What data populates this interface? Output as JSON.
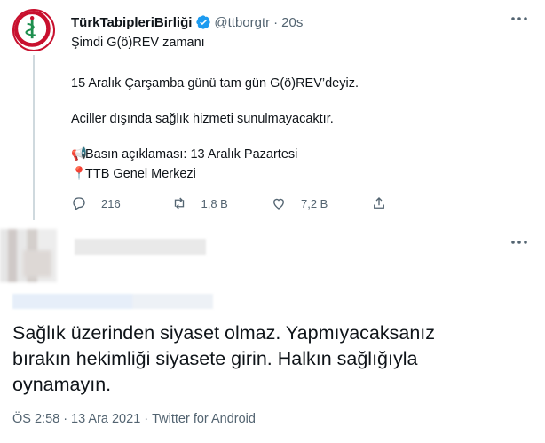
{
  "quoted_tweet": {
    "display_name": "TürkTabipleriBirliği",
    "handle": "@ttborgtr",
    "separator": "·",
    "time": "20s",
    "lines": [
      "Şimdi G(ö)REV zamanı",
      "15 Aralık Çarşamba günü tam gün G(ö)REV’deyiz.",
      "Aciller dışında sağlık hizmeti sunulmayacaktır."
    ],
    "press": {
      "emoji": "📢",
      "text": "Basın açıklaması: 13 Aralık Pazartesi"
    },
    "location": {
      "emoji": "📍",
      "text": "TTB Genel Merkezi"
    },
    "stats": {
      "replies": "216",
      "retweets": "1,8 B",
      "likes": "7,2 B"
    }
  },
  "reply_tweet": {
    "text_lines": [
      "Sağlık üzerinden siyaset olmaz. Yapmıyacaksanız",
      "bırakın hekimliği siyasete girin. Halkın sağlığıyla",
      "oynamayın."
    ],
    "time": "ÖS 2:58",
    "date": "13 Ara 2021",
    "client": "Twitter for Android",
    "separator": "·"
  },
  "colors": {
    "text": "#0f1419",
    "secondary": "#536471",
    "verified": "#1d9bf0",
    "ttb_red": "#c8102e",
    "ttb_green": "#1e8f4e"
  }
}
